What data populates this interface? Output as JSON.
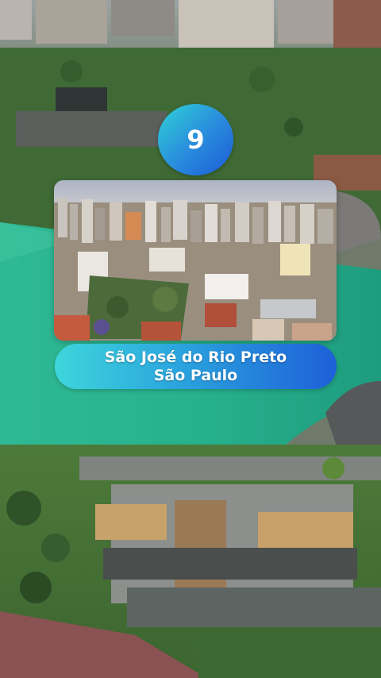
{
  "rank": "9",
  "caption": {
    "city": "São José do Rio Preto",
    "state": "São Paulo"
  }
}
